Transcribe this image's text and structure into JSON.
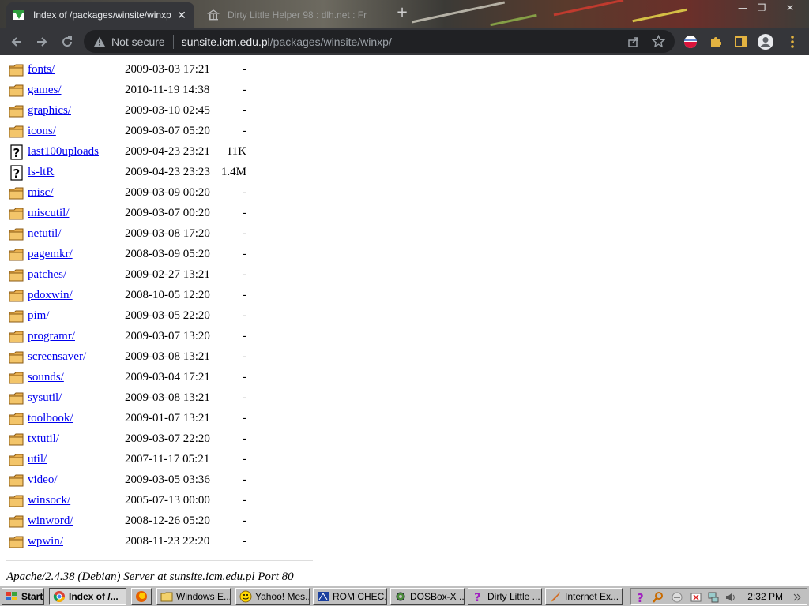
{
  "browser": {
    "tabs": [
      {
        "title": "Index of /packages/winsite/winxp",
        "active": true
      },
      {
        "title": "Dirty Little Helper 98 : dlh.net : Fr",
        "active": false
      }
    ],
    "toolbar": {
      "security_text": "Not secure",
      "url_host": "sunsite.icm.edu.pl",
      "url_path": "/packages/winsite/winxp/"
    }
  },
  "listing": {
    "rows": [
      {
        "type": "folder",
        "name": "fonts/",
        "date": "2009-03-03 17:21",
        "size": "-"
      },
      {
        "type": "folder",
        "name": "games/",
        "date": "2010-11-19 14:38",
        "size": "-"
      },
      {
        "type": "folder",
        "name": "graphics/",
        "date": "2009-03-10 02:45",
        "size": "-"
      },
      {
        "type": "folder",
        "name": "icons/",
        "date": "2009-03-07 05:20",
        "size": "-"
      },
      {
        "type": "unknown",
        "name": "last100uploads",
        "date": "2009-04-23 23:21",
        "size": "11K"
      },
      {
        "type": "unknown",
        "name": "ls-ltR",
        "date": "2009-04-23 23:23",
        "size": "1.4M"
      },
      {
        "type": "folder",
        "name": "misc/",
        "date": "2009-03-09 00:20",
        "size": "-"
      },
      {
        "type": "folder",
        "name": "miscutil/",
        "date": "2009-03-07 00:20",
        "size": "-"
      },
      {
        "type": "folder",
        "name": "netutil/",
        "date": "2009-03-08 17:20",
        "size": "-"
      },
      {
        "type": "folder",
        "name": "pagemkr/",
        "date": "2008-03-09 05:20",
        "size": "-"
      },
      {
        "type": "folder",
        "name": "patches/",
        "date": "2009-02-27 13:21",
        "size": "-"
      },
      {
        "type": "folder",
        "name": "pdoxwin/",
        "date": "2008-10-05 12:20",
        "size": "-"
      },
      {
        "type": "folder",
        "name": "pim/",
        "date": "2009-03-05 22:20",
        "size": "-"
      },
      {
        "type": "folder",
        "name": "programr/",
        "date": "2009-03-07 13:20",
        "size": "-"
      },
      {
        "type": "folder",
        "name": "screensaver/",
        "date": "2009-03-08 13:21",
        "size": "-"
      },
      {
        "type": "folder",
        "name": "sounds/",
        "date": "2009-03-04 17:21",
        "size": "-"
      },
      {
        "type": "folder",
        "name": "sysutil/",
        "date": "2009-03-08 13:21",
        "size": "-"
      },
      {
        "type": "folder",
        "name": "toolbook/",
        "date": "2009-01-07 13:21",
        "size": "-"
      },
      {
        "type": "folder",
        "name": "txtutil/",
        "date": "2009-03-07 22:20",
        "size": "-"
      },
      {
        "type": "folder",
        "name": "util/",
        "date": "2007-11-17 05:21",
        "size": "-"
      },
      {
        "type": "folder",
        "name": "video/",
        "date": "2009-03-05 03:36",
        "size": "-"
      },
      {
        "type": "folder",
        "name": "winsock/",
        "date": "2005-07-13 00:00",
        "size": "-"
      },
      {
        "type": "folder",
        "name": "winword/",
        "date": "2008-12-26 05:20",
        "size": "-"
      },
      {
        "type": "folder",
        "name": "wpwin/",
        "date": "2008-11-23 22:20",
        "size": "-"
      }
    ],
    "footer": "Apache/2.4.38 (Debian) Server at sunsite.icm.edu.pl Port 80"
  },
  "taskbar": {
    "start_label": "Start",
    "items": [
      {
        "label": "Index of /...",
        "icon": "chrome-icon",
        "pressed": true
      },
      {
        "label": "",
        "icon": "firefox-icon",
        "pressed": false
      },
      {
        "label": "Windows E...",
        "icon": "folder-icon",
        "pressed": false
      },
      {
        "label": "Yahoo! Mes...",
        "icon": "smiley-icon",
        "pressed": false
      },
      {
        "label": "ROM CHEC...",
        "icon": "app-icon",
        "pressed": false
      },
      {
        "label": "DOSBox-X ...",
        "icon": "gear-icon",
        "pressed": false
      },
      {
        "label": "Dirty Little ...",
        "icon": "help-icon",
        "pressed": false
      },
      {
        "label": "Internet Ex...",
        "icon": "rocket-icon",
        "pressed": false
      }
    ],
    "clock": "2:32 PM"
  },
  "colors": {
    "link": "#0000ee",
    "toolbar_bg": "#35363a",
    "omnibox_bg": "#202124",
    "taskbar_bg": "#c0c0c0",
    "folder_fill": "#f3c56a"
  }
}
